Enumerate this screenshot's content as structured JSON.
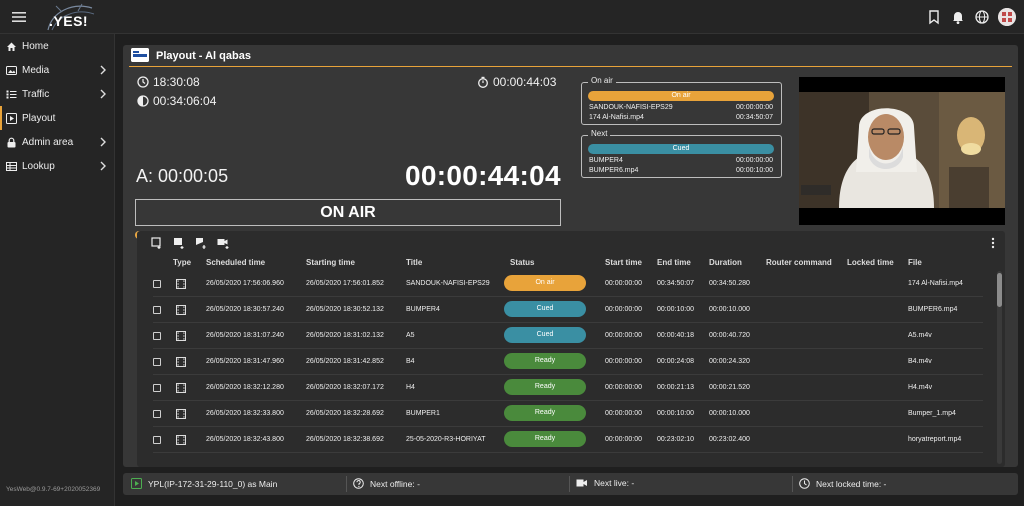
{
  "app": {
    "logo_text": ".YES!",
    "version": "YesWeb@0.9.7-69+2020052369"
  },
  "sidebar": {
    "items": [
      {
        "label": "Home",
        "icon": "home-icon",
        "chevron": false
      },
      {
        "label": "Media",
        "icon": "image-icon",
        "chevron": true
      },
      {
        "label": "Traffic",
        "icon": "list-icon",
        "chevron": true
      },
      {
        "label": "Playout",
        "icon": "play-box-icon",
        "chevron": false,
        "active": true
      },
      {
        "label": "Admin area",
        "icon": "lock-icon",
        "chevron": true
      },
      {
        "label": "Lookup",
        "icon": "table-icon",
        "chevron": true
      }
    ]
  },
  "panel": {
    "title": "Playout - Al qabas",
    "clock_time": "18:30:08",
    "elapsed_total": "00:34:06:04",
    "timer": "00:00:44:03",
    "a_time": "A: 00:00:05",
    "big_time": "00:00:44:04",
    "on_air_label": "ON AIR",
    "progress": 0.95
  },
  "on_air": {
    "legend": "On air",
    "pill": "On air",
    "lines": [
      {
        "name": "SANDOUK-NAFISI-EPS29",
        "time": "00:00:00:00"
      },
      {
        "name": "174 Al-Nafisi.mp4",
        "time": "00:34:50:07"
      }
    ]
  },
  "next": {
    "legend": "Next",
    "pill": "Cued",
    "lines": [
      {
        "name": "BUMPER4",
        "time": "00:00:00:00"
      },
      {
        "name": "BUMPER6.mp4",
        "time": "00:00:10:00"
      }
    ]
  },
  "table": {
    "columns": [
      "Type",
      "Scheduled time",
      "Starting time",
      "Title",
      "Status",
      "Start time",
      "End time",
      "Duration",
      "Router command",
      "Locked time",
      "File"
    ],
    "rows": [
      {
        "scheduled": "26/05/2020 17:56:06.960",
        "starting": "26/05/2020 17:56:01.852",
        "title": "SANDOUK-NAFISI-EPS29",
        "status": "On air",
        "start": "00:00:00:00",
        "end": "00:34:50:07",
        "duration": "00:34:50.280",
        "file": "174 Al-Nafisi.mp4"
      },
      {
        "scheduled": "26/05/2020 18:30:57.240",
        "starting": "26/05/2020 18:30:52.132",
        "title": "BUMPER4",
        "status": "Cued",
        "start": "00:00:00:00",
        "end": "00:00:10:00",
        "duration": "00:00:10.000",
        "file": "BUMPER6.mp4"
      },
      {
        "scheduled": "26/05/2020 18:31:07.240",
        "starting": "26/05/2020 18:31:02.132",
        "title": "A5",
        "status": "Cued",
        "start": "00:00:00:00",
        "end": "00:00:40:18",
        "duration": "00:00:40.720",
        "file": "A5.m4v"
      },
      {
        "scheduled": "26/05/2020 18:31:47.960",
        "starting": "26/05/2020 18:31:42.852",
        "title": "B4",
        "status": "Ready",
        "start": "00:00:00:00",
        "end": "00:00:24:08",
        "duration": "00:00:24.320",
        "file": "B4.m4v"
      },
      {
        "scheduled": "26/05/2020 18:32:12.280",
        "starting": "26/05/2020 18:32:07.172",
        "title": "H4",
        "status": "Ready",
        "start": "00:00:00:00",
        "end": "00:00:21:13",
        "duration": "00:00:21.520",
        "file": "H4.m4v"
      },
      {
        "scheduled": "26/05/2020 18:32:33.800",
        "starting": "26/05/2020 18:32:28.692",
        "title": "BUMPER1",
        "status": "Ready",
        "start": "00:00:00:00",
        "end": "00:00:10:00",
        "duration": "00:00:10.000",
        "file": "Bumper_1.mp4"
      },
      {
        "scheduled": "26/05/2020 18:32:43.800",
        "starting": "26/05/2020 18:32:38.692",
        "title": "25-05-2020-R3-HORIYAT",
        "status": "Ready",
        "start": "00:00:00:00",
        "end": "00:23:02:10",
        "duration": "00:23:02.400",
        "file": "horyatreport.mp4"
      }
    ]
  },
  "statusbar": {
    "main": "YPL(IP-172-31-29-110_0) as Main",
    "next_offline": "Next offline: -",
    "next_live": "Next live: -",
    "next_locked": "Next locked time: -"
  },
  "colors": {
    "accent": "#e8a33a",
    "on_air": "#e8a33a",
    "cued": "#3a8fa3",
    "ready": "#4a8a3c"
  }
}
